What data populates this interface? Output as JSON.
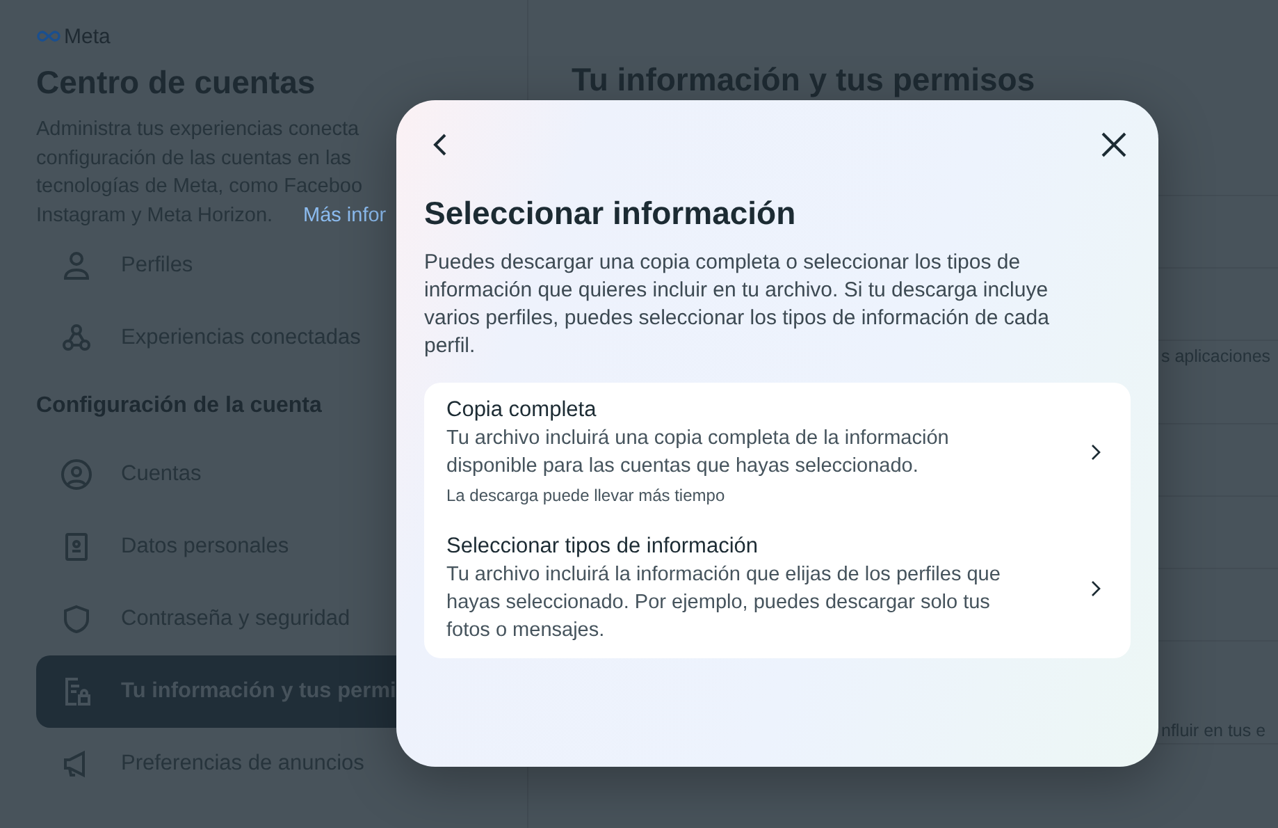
{
  "sidebar": {
    "brand": "Meta",
    "title": "Centro de cuentas",
    "description_lines": [
      "Administra tus experiencias conecta",
      "configuración de las cuentas en las",
      "tecnologías de Meta, como Faceboo",
      "Instagram y Meta Horizon."
    ],
    "link": "Más infor",
    "sections": [
      {
        "items": [
          {
            "label": "Perfiles",
            "selected": false
          },
          {
            "label": "Experiencias conectadas",
            "selected": false
          }
        ]
      },
      {
        "heading": "Configuración de la cuenta",
        "items": [
          {
            "label": "Cuentas",
            "selected": false
          },
          {
            "label": "Datos personales",
            "selected": false
          },
          {
            "label": "Contraseña y seguridad",
            "selected": false
          },
          {
            "label": "Tu información y tus permi",
            "selected": true
          },
          {
            "label": "Preferencias de anuncios",
            "selected": false
          }
        ]
      }
    ]
  },
  "main": {
    "title": "Tu información y tus permisos",
    "row_fragments": [
      "s aplicaciones",
      "nfluir en tus e"
    ]
  },
  "dialog": {
    "title": "Seleccionar información",
    "description": "Puedes descargar una copia completa o seleccionar los tipos de información que quieres incluir en tu archivo. Si tu descarga incluye varios perfiles, puedes seleccionar los tipos de información de cada perfil.",
    "options": [
      {
        "title": "Copia completa",
        "description": "Tu archivo incluirá una copia completa de la información disponible para las cuentas que hayas seleccionado.",
        "note": "La descarga puede llevar más tiempo"
      },
      {
        "title": "Seleccionar tipos de información",
        "description": "Tu archivo incluirá la información que elijas de los perfiles que hayas seleccionado. Por ejemplo, puedes descargar solo tus fotos o mensajes."
      }
    ]
  }
}
